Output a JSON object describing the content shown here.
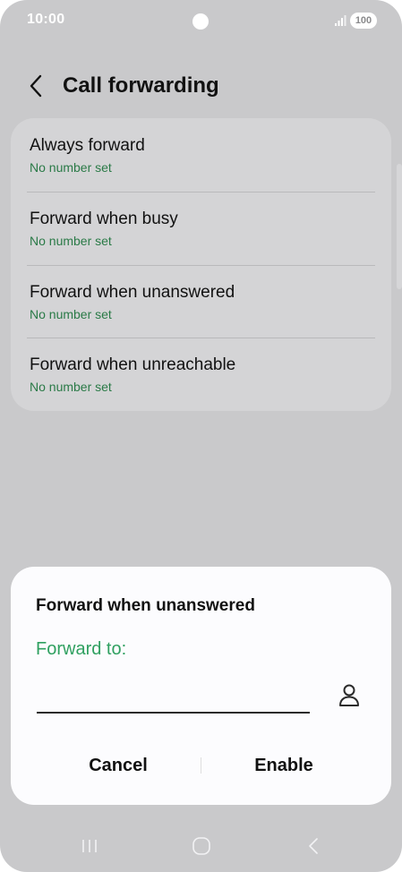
{
  "status_bar": {
    "time": "10:00",
    "battery": "100"
  },
  "header": {
    "title": "Call forwarding"
  },
  "settings": {
    "items": [
      {
        "title": "Always forward",
        "subtitle": "No number set"
      },
      {
        "title": "Forward when busy",
        "subtitle": "No number set"
      },
      {
        "title": "Forward when unanswered",
        "subtitle": "No number set"
      },
      {
        "title": "Forward when unreachable",
        "subtitle": "No number set"
      }
    ]
  },
  "dialog": {
    "title": "Forward when unanswered",
    "field_label": "Forward to:",
    "input_value": "",
    "cancel_label": "Cancel",
    "enable_label": "Enable"
  },
  "icons": {
    "back": "back-chevron-icon",
    "contact": "person-icon",
    "nav_recent": "recent-apps-icon",
    "nav_home": "home-icon",
    "nav_back": "nav-back-icon"
  },
  "colors": {
    "accent_green": "#2fa060",
    "subtitle_green": "#2a7a47",
    "scrim_background": "#c9c9cb",
    "dialog_background": "#fcfcfe"
  }
}
